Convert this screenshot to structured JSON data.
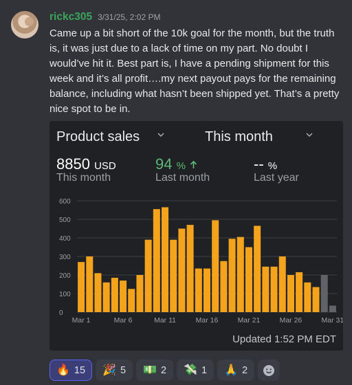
{
  "author": {
    "username": "rickc305",
    "timestamp": "3/31/25, 2:02 PM"
  },
  "message": {
    "text": "Came up a bit short of the 10k goal for the month, but the truth is, it was just due to a lack of time on my part. No doubt I would’ve hit it. Best part is, I have a pending shipment for this week and it’s all profit….my next payout pays for the remaining balance, including what hasn’t been shipped yet. That’s a pretty nice spot to be in."
  },
  "embed": {
    "metric_select": "Product sales",
    "period_select": "This month",
    "stats": [
      {
        "value": "8850",
        "unit": "USD",
        "label": "This month",
        "icon": ""
      },
      {
        "value": "94",
        "unit": "%",
        "label": "Last month",
        "icon": "arrow-up-icon"
      },
      {
        "value": "--",
        "unit": "%",
        "label": "Last year",
        "icon": ""
      }
    ],
    "updated": "Updated 1:52 PM EDT",
    "colors": {
      "bar": "#f4a41c",
      "bar_projected": "#5f6368",
      "accent_green": "#5bb974"
    }
  },
  "chart_data": {
    "type": "bar",
    "x_tick_labels": [
      "Mar 1",
      "Mar 6",
      "Mar 11",
      "Mar 16",
      "Mar 21",
      "Mar 26",
      "Mar 31"
    ],
    "y_tick_labels": [
      "0",
      "100",
      "200",
      "300",
      "400",
      "500",
      "600"
    ],
    "ylim": [
      0,
      600
    ],
    "grid": true,
    "categories": [
      1,
      2,
      3,
      4,
      5,
      6,
      7,
      8,
      9,
      10,
      11,
      12,
      13,
      14,
      15,
      16,
      17,
      18,
      19,
      20,
      21,
      22,
      23,
      24,
      25,
      26,
      27,
      28,
      29,
      30,
      31
    ],
    "values": [
      270,
      300,
      210,
      160,
      185,
      170,
      125,
      200,
      390,
      555,
      565,
      390,
      450,
      470,
      235,
      235,
      495,
      275,
      395,
      405,
      350,
      465,
      245,
      245,
      300,
      200,
      215,
      160,
      135,
      200,
      35
    ],
    "projected_days": [
      30,
      31
    ]
  },
  "reactions": [
    {
      "emoji": "🔥",
      "count": "15",
      "active": true
    },
    {
      "emoji": "🎉",
      "count": "5",
      "active": false
    },
    {
      "emoji": "💵",
      "count": "2",
      "active": false
    },
    {
      "emoji": "💸",
      "count": "1",
      "active": false
    },
    {
      "emoji": "🙏",
      "count": "2",
      "active": false
    }
  ],
  "add_reaction_icon": "smiley-plus-icon"
}
